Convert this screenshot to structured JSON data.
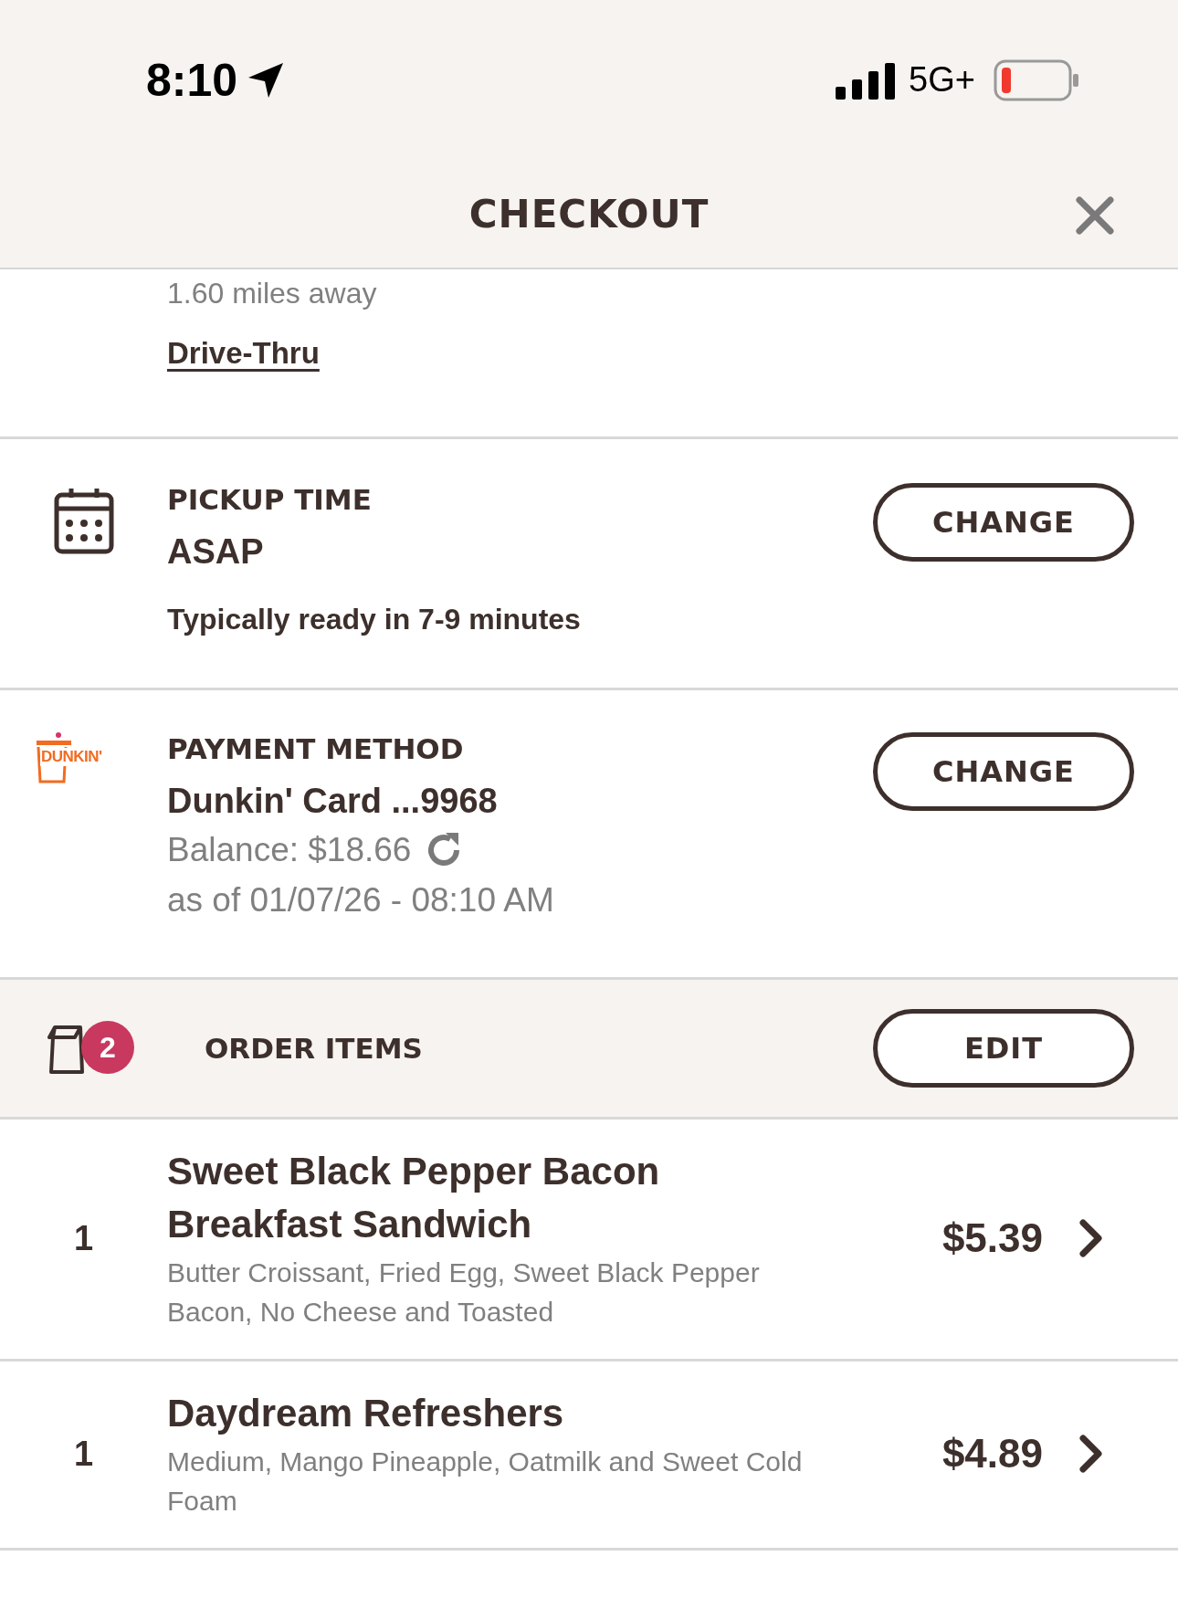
{
  "status_bar": {
    "time": "8:10",
    "network": "5G+"
  },
  "header": {
    "title": "CHECKOUT"
  },
  "location": {
    "distance": "1.60 miles away",
    "mode_link": "Drive-Thru"
  },
  "pickup": {
    "title": "PICKUP TIME",
    "value": "ASAP",
    "note": "Typically ready in 7-9 minutes",
    "button": "CHANGE"
  },
  "payment": {
    "logo_text": "DUNKIN'",
    "title": "PAYMENT METHOD",
    "card": "Dunkin' Card ...9968",
    "balance": "Balance: $18.66",
    "as_of": "as of 01/07/26 - 08:10 AM",
    "button": "CHANGE"
  },
  "order": {
    "title": "ORDER ITEMS",
    "count": "2",
    "button": "EDIT",
    "items": [
      {
        "quantity": "1",
        "name": "Sweet Black Pepper Bacon Breakfast Sandwich",
        "details": "Butter Croissant, Fried Egg, Sweet Black Pepper Bacon, No Cheese and Toasted",
        "price": "$5.39"
      },
      {
        "quantity": "1",
        "name": "Daydream Refreshers",
        "details": "Medium, Mango Pineapple, Oatmilk and Sweet Cold Foam",
        "price": "$4.89"
      }
    ]
  }
}
